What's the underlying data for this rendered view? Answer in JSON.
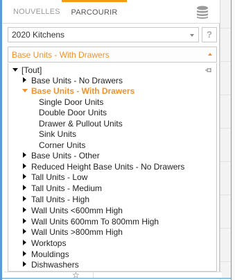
{
  "tabs": {
    "new_label": "NOUVELLES",
    "browse_label": "PARCOURIR",
    "active": "browse",
    "accent_color": "#f39c12"
  },
  "catalog": {
    "selected": "2020 Kitchens",
    "help_label": "?"
  },
  "category": {
    "selected": "Base Units - With Drawers"
  },
  "tree": {
    "root": "[Tout]",
    "items": [
      {
        "label": "Base Units - No Drawers",
        "state": "collapsed"
      },
      {
        "label": "Base Units - With Drawers",
        "state": "expanded",
        "selected": true,
        "children": [
          "Single Door Units",
          "Double Door Units",
          "Drawer & Pullout Units",
          "Sink Units",
          "Corner Units"
        ]
      },
      {
        "label": "Base Units - Other",
        "state": "collapsed"
      },
      {
        "label": "Reduced Height Base Units - No Drawers",
        "state": "collapsed"
      },
      {
        "label": "Tall Units - Low",
        "state": "collapsed"
      },
      {
        "label": "Tall Units - Medium",
        "state": "collapsed"
      },
      {
        "label": "Tall Units - High",
        "state": "collapsed"
      },
      {
        "label": "Wall Units <600mm High",
        "state": "collapsed"
      },
      {
        "label": "Wall Units 600mm To 800mm High",
        "state": "collapsed"
      },
      {
        "label": "Wall Units >800mm High",
        "state": "collapsed"
      },
      {
        "label": "Worktops",
        "state": "collapsed"
      },
      {
        "label": "Mouldings",
        "state": "collapsed"
      },
      {
        "label": "Dishwashers",
        "state": "collapsed"
      }
    ]
  },
  "icons": {
    "database": "database-icon",
    "pin": "pin-icon",
    "star": "star-icon",
    "star_glyph": "☆"
  },
  "colors": {
    "selected_text": "#f0912a",
    "frame": "#5b9bd5"
  }
}
